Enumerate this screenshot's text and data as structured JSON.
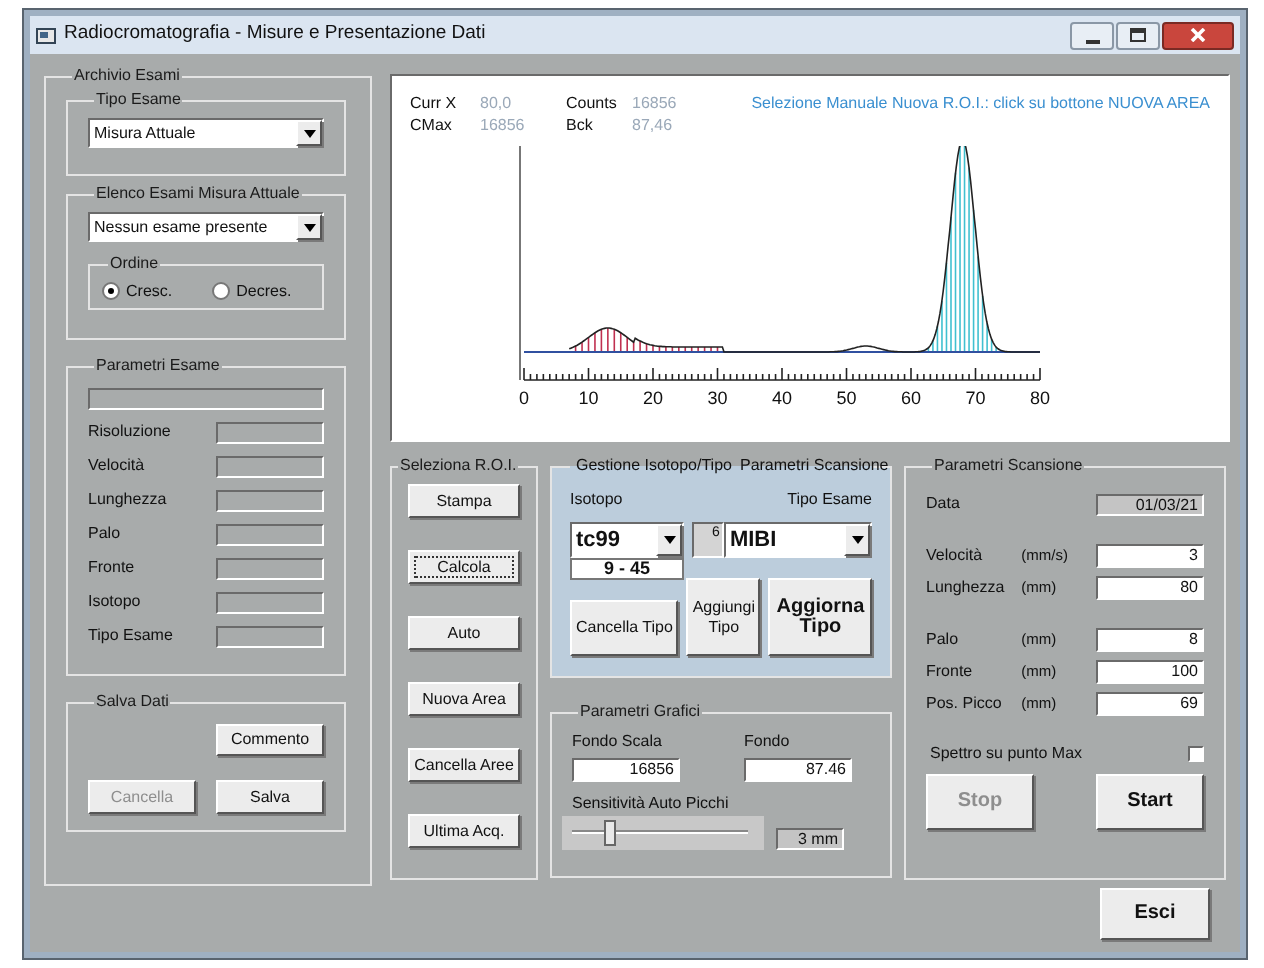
{
  "window": {
    "title": "Radiocromatografia - Misure e Presentazione Dati"
  },
  "archive": {
    "title": "Archivio Esami",
    "exam_type": {
      "title": "Tipo Esame",
      "value": "Misura Attuale"
    },
    "exam_list": {
      "title": "Elenco Esami Misura Attuale",
      "value": "Nessun esame presente",
      "order": {
        "title": "Ordine",
        "options": [
          {
            "label": "Cresc.",
            "selected": true
          },
          {
            "label": "Decres.",
            "selected": false
          }
        ]
      }
    },
    "exam_params": {
      "title": "Parametri Esame",
      "rows": [
        "Risoluzione",
        "Velocità",
        "Lunghezza",
        "Palo",
        "Fronte",
        "Isotopo",
        "Tipo Esame"
      ]
    },
    "save": {
      "title": "Salva Dati",
      "comment_button": "Commento",
      "buttons": [
        {
          "label": "Cancella",
          "disabled": true
        },
        {
          "label": "Salva",
          "disabled": false
        }
      ]
    }
  },
  "chart": {
    "readouts": [
      {
        "label": "Curr X",
        "value": "80,0"
      },
      {
        "label": "Counts",
        "value": "16856"
      },
      {
        "label": "CMax",
        "value": "16856"
      },
      {
        "label": "Bck",
        "value": "87,46"
      }
    ],
    "hint": "Selezione Manuale Nuova R.O.I.: click su bottone NUOVA AREA",
    "axis_labels": [
      "0",
      "10",
      "20",
      "30",
      "40",
      "50",
      "60",
      "70",
      "80"
    ]
  },
  "roi": {
    "title": "Seleziona R.O.I.",
    "buttons": [
      {
        "label": "Stampa",
        "focused": false
      },
      {
        "label": "Calcola",
        "focused": true
      },
      {
        "label": "Auto",
        "focused": false
      },
      {
        "label": "Nuova Area",
        "focused": false
      },
      {
        "label": "Cancella Aree",
        "focused": false
      },
      {
        "label": "Ultima Acq.",
        "focused": false
      }
    ]
  },
  "isotope": {
    "title": "Gestione Isotopo/Tipo",
    "title_right": "Parametri Scansione",
    "isotope_label": "Isotopo",
    "isotope_value": "tc99",
    "range": "9 - 45",
    "type_label": "Tipo Esame",
    "type_index": "6",
    "type_value": "MIBI",
    "cancel_button": "Cancella Tipo",
    "buttons": [
      {
        "label": "Aggiungi Tipo",
        "bold": false
      },
      {
        "label": "Aggiorna Tipo",
        "bold": true
      }
    ]
  },
  "graphics": {
    "title": "Parametri Grafici",
    "fields": [
      {
        "label": "Fondo Scala",
        "value": "16856"
      },
      {
        "label": "Fondo",
        "value": "87.46"
      }
    ],
    "sensitivity": {
      "label": "Sensitività Auto Picchi",
      "level": 0.18,
      "reading": "3 mm"
    }
  },
  "scan": {
    "title": "Parametri Scansione",
    "date": {
      "label": "Data",
      "value": "01/03/21"
    },
    "field_groups": [
      {
        "fields": [
          {
            "label": "Velocità",
            "unit": "(mm/s)",
            "value": "3"
          },
          {
            "label": "Lunghezza",
            "unit": "(mm)",
            "value": "80"
          }
        ]
      },
      {
        "fields": [
          {
            "label": "Palo",
            "unit": "(mm)",
            "value": "8"
          },
          {
            "label": "Fronte",
            "unit": "(mm)",
            "value": "100"
          },
          {
            "label": "Pos. Picco",
            "unit": "(mm)",
            "value": "69"
          }
        ]
      }
    ],
    "max_spectrum": {
      "label": "Spettro su punto Max",
      "checked": false
    },
    "buttons": [
      {
        "label": "Stop",
        "disabled": true
      },
      {
        "label": "Start",
        "disabled": false
      }
    ]
  },
  "exit_button": "Esci"
}
